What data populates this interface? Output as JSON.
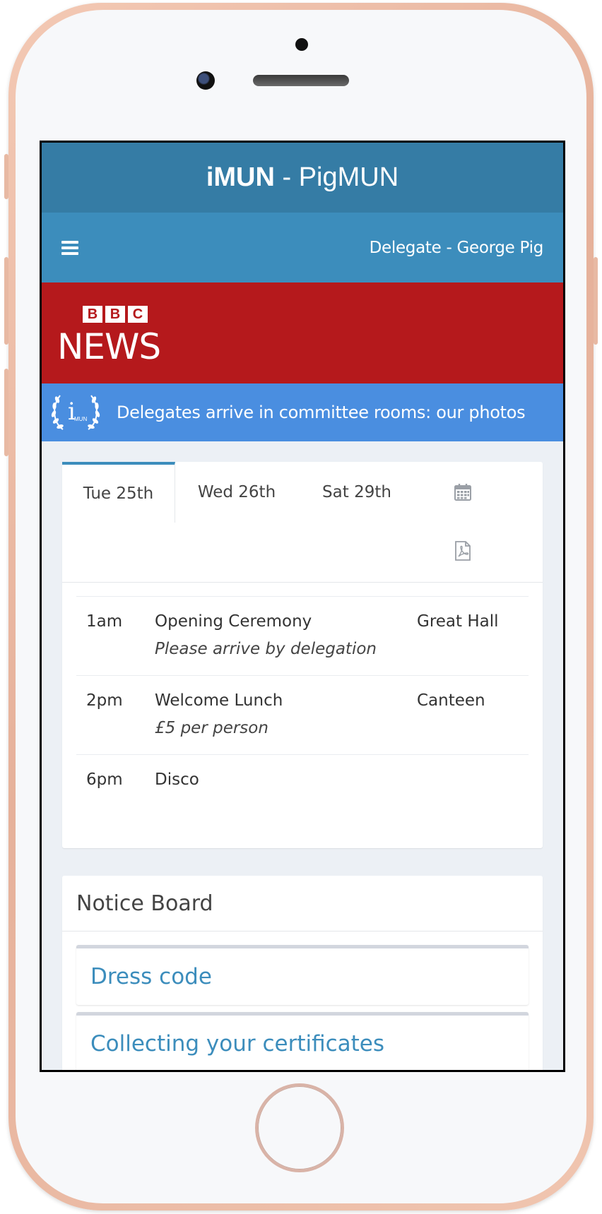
{
  "app": {
    "title_bold": "iMUN",
    "title_rest": " - PigMUN"
  },
  "navbar": {
    "menu_icon": "hamburger-menu-icon",
    "user_label": "Delegate - George Pig"
  },
  "news_banner": {
    "bbc_letters": [
      "B",
      "B",
      "C"
    ],
    "news_word": "NEWS",
    "color": "#b5191c"
  },
  "ticker": {
    "logo_icon": "imun-laurel-logo",
    "logo_text": "i",
    "logo_subtext": "MUN",
    "text": "Delegates arrive in committee rooms: our photos",
    "color": "#4a8ee0"
  },
  "schedule": {
    "tabs": [
      {
        "label": "Tue 25th",
        "active": true
      },
      {
        "label": "Wed 26th",
        "active": false
      },
      {
        "label": "Sat 29th",
        "active": false
      }
    ],
    "calendar_icon": "calendar-icon",
    "pdf_icon": "pdf-file-icon",
    "events": [
      {
        "time": "1am",
        "title": "Opening Ceremony",
        "note": "Please arrive by delegation",
        "location": "Great Hall"
      },
      {
        "time": "2pm",
        "title": "Welcome Lunch",
        "note": "£5 per person",
        "location": "Canteen"
      },
      {
        "time": "6pm",
        "title": "Disco",
        "note": "",
        "location": ""
      }
    ]
  },
  "notice_board": {
    "heading": "Notice Board",
    "items": [
      {
        "label": "Dress code"
      },
      {
        "label": "Collecting your certificates"
      }
    ]
  },
  "colors": {
    "header_dark": "#357ca5",
    "header": "#3c8dbc",
    "link": "#3c8dbc",
    "background": "#ecf0f5"
  }
}
